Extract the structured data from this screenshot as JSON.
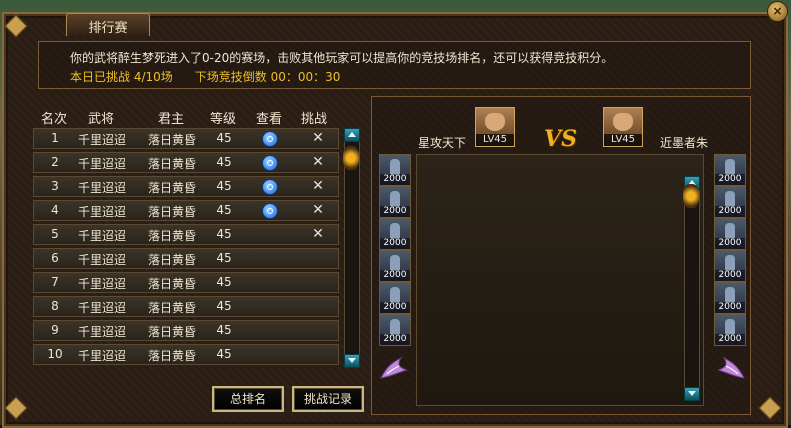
{
  "window": {
    "title": "排行赛",
    "close_glyph": "×"
  },
  "info": {
    "line1": "你的武将醉生梦死进入了0-20的赛场，击败其他玩家可以提高你的竞技场排名，还可以获得竞技积分。",
    "challenges_today": "本日已挑战 4/10场",
    "countdown": "下场竞技倒数 00：00：30"
  },
  "ranking": {
    "headers": [
      "名次",
      "武将",
      "君主",
      "等级",
      "查看",
      "挑战"
    ],
    "rows": [
      {
        "rank": "1",
        "general": "千里迢迢",
        "lord": "落日黄昏",
        "level": "45",
        "view": true,
        "challenge": true
      },
      {
        "rank": "2",
        "general": "千里迢迢",
        "lord": "落日黄昏",
        "level": "45",
        "view": true,
        "challenge": true
      },
      {
        "rank": "3",
        "general": "千里迢迢",
        "lord": "落日黄昏",
        "level": "45",
        "view": true,
        "challenge": true
      },
      {
        "rank": "4",
        "general": "千里迢迢",
        "lord": "落日黄昏",
        "level": "45",
        "view": true,
        "challenge": true
      },
      {
        "rank": "5",
        "general": "千里迢迢",
        "lord": "落日黄昏",
        "level": "45",
        "view": false,
        "challenge": true
      },
      {
        "rank": "6",
        "general": "千里迢迢",
        "lord": "落日黄昏",
        "level": "45",
        "view": false,
        "challenge": false
      },
      {
        "rank": "7",
        "general": "千里迢迢",
        "lord": "落日黄昏",
        "level": "45",
        "view": false,
        "challenge": false
      },
      {
        "rank": "8",
        "general": "千里迢迢",
        "lord": "落日黄昏",
        "level": "45",
        "view": false,
        "challenge": false
      },
      {
        "rank": "9",
        "general": "千里迢迢",
        "lord": "落日黄昏",
        "level": "45",
        "view": false,
        "challenge": false
      },
      {
        "rank": "10",
        "general": "千里迢迢",
        "lord": "落日黄昏",
        "level": "45",
        "view": false,
        "challenge": false
      }
    ]
  },
  "buttons": {
    "total_rank": "总排名",
    "challenge_log": "挑战记录"
  },
  "battle": {
    "left_player": {
      "name": "星攻天下",
      "level": "LV45"
    },
    "right_player": {
      "name": "近墨者朱",
      "level": "LV45"
    },
    "vs_label": "VS",
    "left_units": [
      "2000",
      "2000",
      "2000",
      "2000",
      "2000",
      "2000"
    ],
    "right_units": [
      "2000",
      "2000",
      "2000",
      "2000",
      "2000",
      "2000"
    ]
  },
  "colors": {
    "highlight": "#f0c020",
    "frame": "#8a6a3a",
    "accent_scroll": "#1a8a9a"
  }
}
